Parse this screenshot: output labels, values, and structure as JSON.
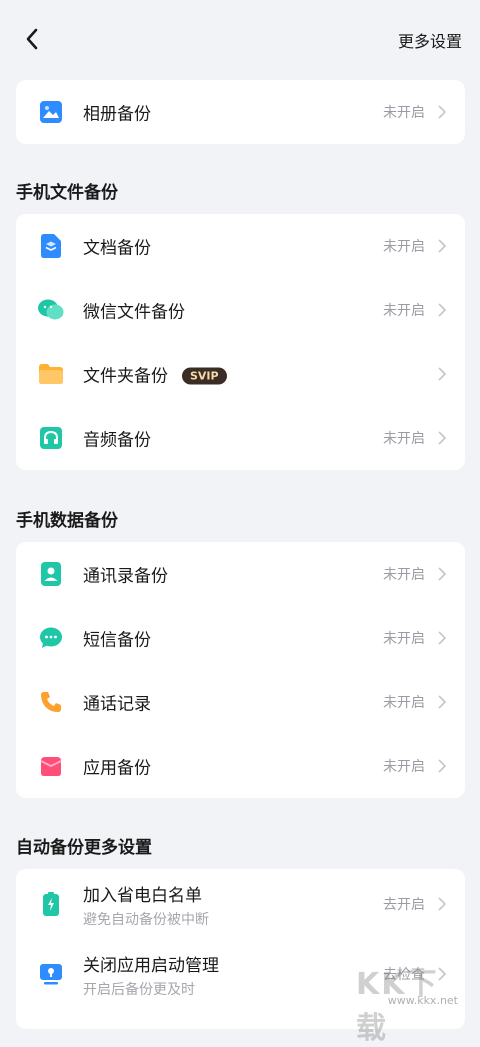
{
  "header": {
    "more_settings": "更多设置"
  },
  "album": {
    "label": "相册备份",
    "status": "未开启",
    "icon": "image-icon"
  },
  "file_section": {
    "title": "手机文件备份",
    "items": [
      {
        "label": "文档备份",
        "status": "未开启",
        "icon": "document-icon"
      },
      {
        "label": "微信文件备份",
        "status": "未开启",
        "icon": "wechat-icon"
      },
      {
        "label": "文件夹备份",
        "badge": "SVIP",
        "status": "",
        "icon": "folder-icon"
      },
      {
        "label": "音频备份",
        "status": "未开启",
        "icon": "headphones-icon"
      }
    ]
  },
  "data_section": {
    "title": "手机数据备份",
    "items": [
      {
        "label": "通讯录备份",
        "status": "未开启",
        "icon": "contacts-icon"
      },
      {
        "label": "短信备份",
        "status": "未开启",
        "icon": "message-icon"
      },
      {
        "label": "通话记录",
        "status": "未开启",
        "icon": "phone-icon"
      },
      {
        "label": "应用备份",
        "status": "未开启",
        "icon": "app-box-icon"
      }
    ]
  },
  "auto_section": {
    "title": "自动备份更多设置",
    "items": [
      {
        "label": "加入省电白名单",
        "sub": "避免自动备份被中断",
        "status": "去开启",
        "icon": "battery-icon"
      },
      {
        "label": "关闭应用启动管理",
        "sub": "开启后备份更及时",
        "status": "去检查",
        "icon": "launch-manager-icon"
      }
    ]
  },
  "watermark": {
    "big": "KK下载",
    "small": "www.kkx.net"
  },
  "colors": {
    "accent_blue": "#2f8cff",
    "teal": "#1fc7a6",
    "badge_bg": "#3a2d26"
  }
}
